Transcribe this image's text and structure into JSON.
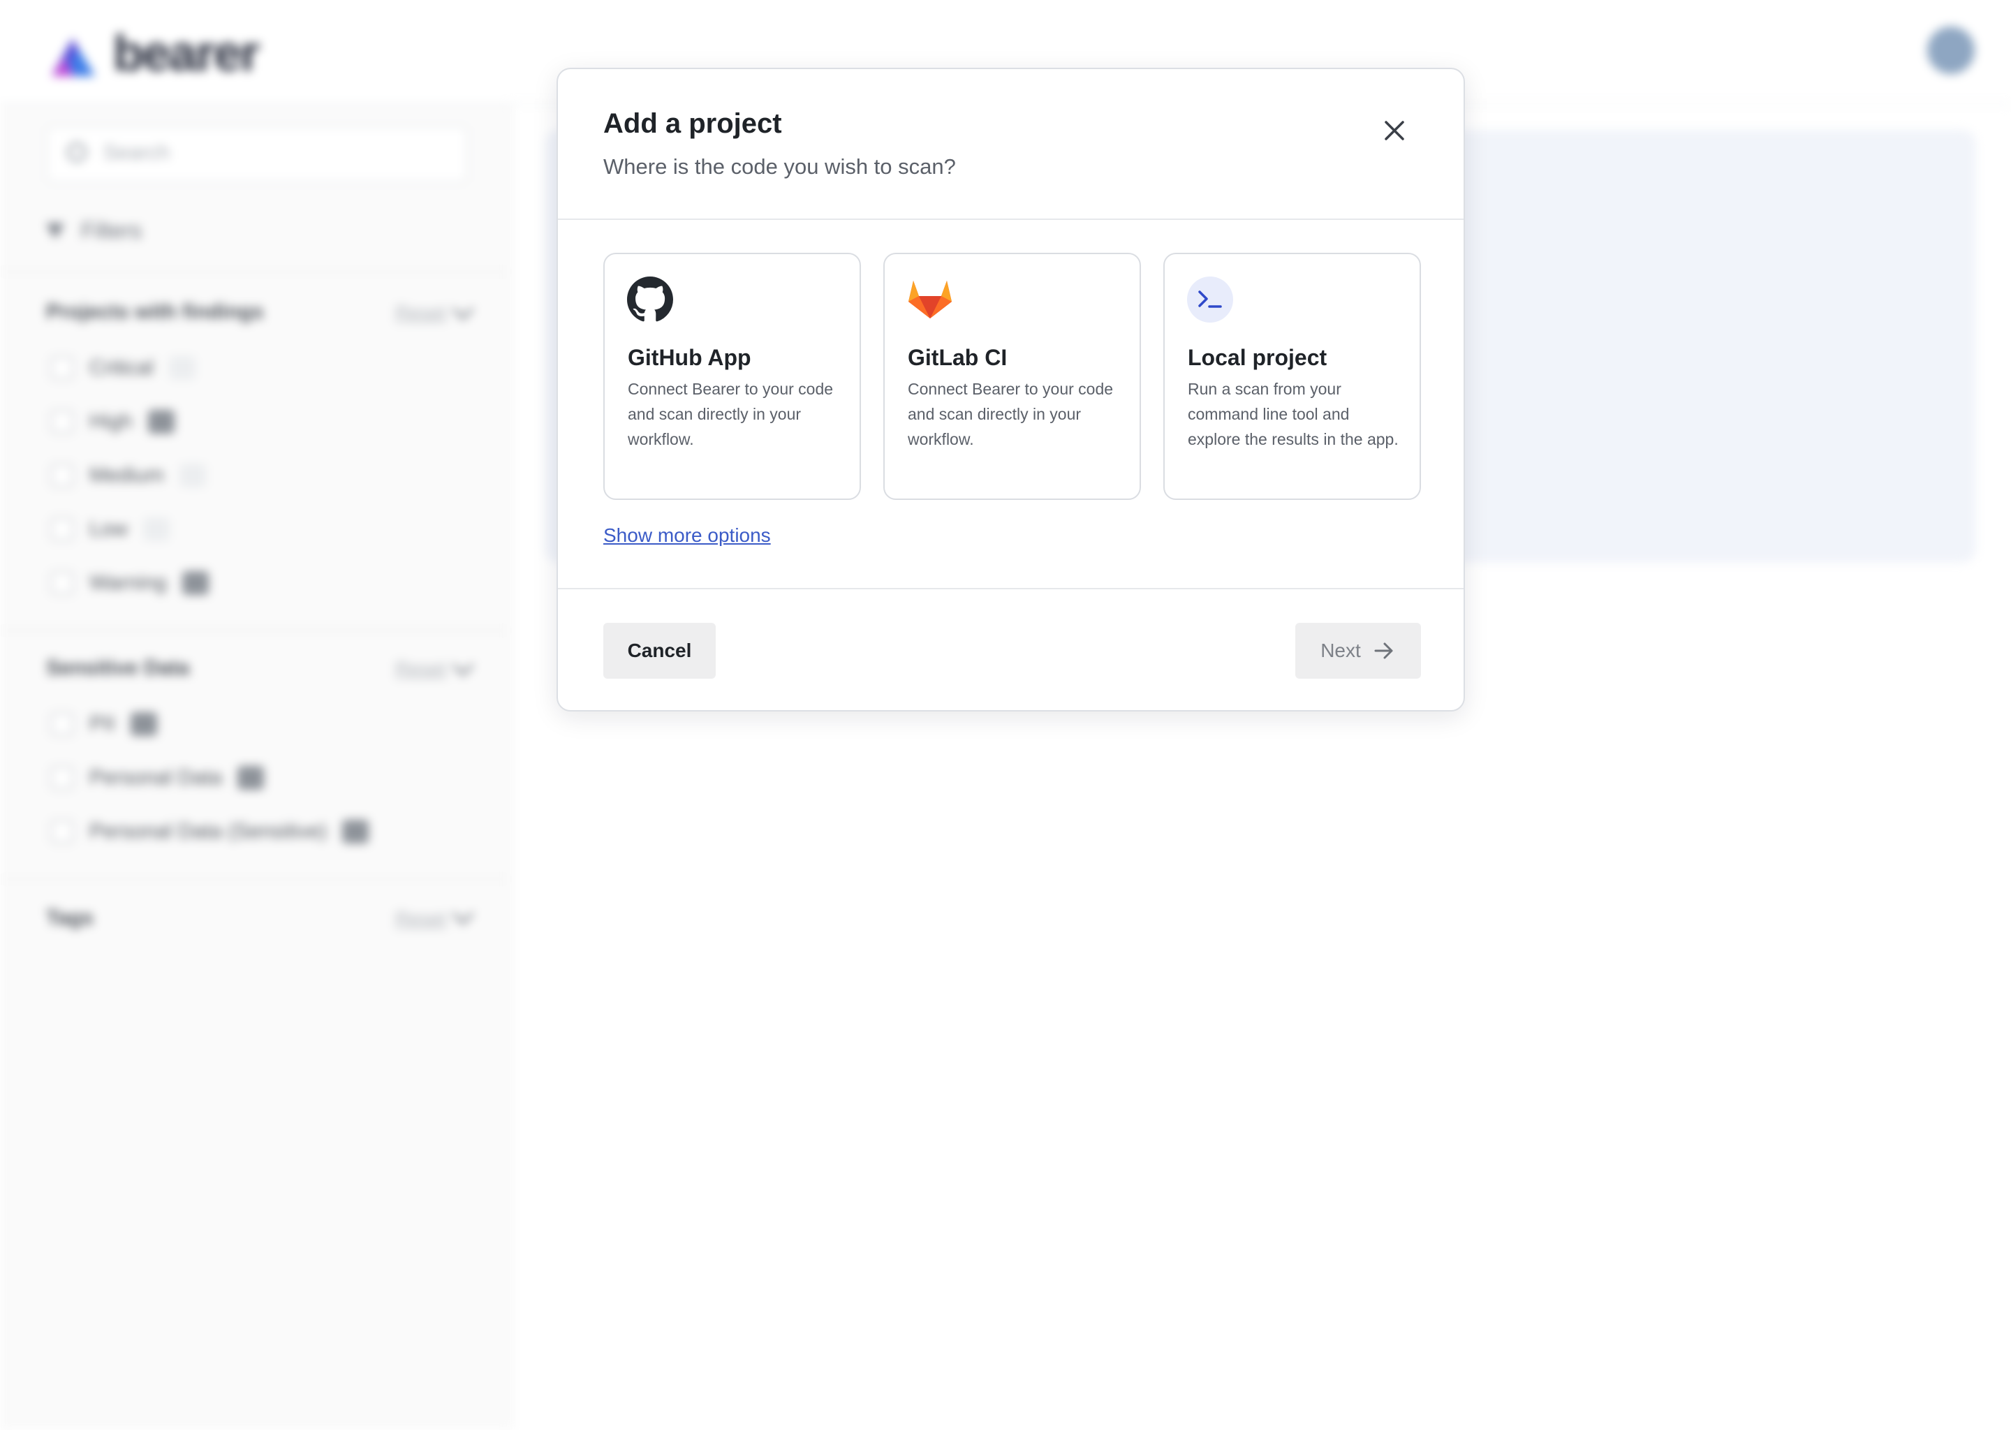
{
  "app": {
    "logo_text": "bearer"
  },
  "sidebar": {
    "search_placeholder": "Search",
    "filters_label": "Filters",
    "sections": [
      {
        "title": "Projects with findings",
        "reset": "Reset",
        "items": [
          {
            "label": "Critical",
            "count": ""
          },
          {
            "label": "High",
            "count": ""
          },
          {
            "label": "Medium",
            "count": ""
          },
          {
            "label": "Low",
            "count": ""
          },
          {
            "label": "Warning",
            "count": ""
          }
        ]
      },
      {
        "title": "Sensitive Data",
        "reset": "Reset",
        "items": [
          {
            "label": "PII",
            "count": ""
          },
          {
            "label": "Personal Data",
            "count": ""
          },
          {
            "label": "Personal Data (Sensitive)",
            "count": ""
          }
        ]
      },
      {
        "title": "Tags",
        "reset": "Reset",
        "items": []
      }
    ]
  },
  "modal": {
    "title": "Add a project",
    "subtitle": "Where is the code you wish to scan?",
    "options": [
      {
        "title": "GitHub App",
        "description": "Connect Bearer to your code and scan directly in your workflow.",
        "icon": "github-icon"
      },
      {
        "title": "GitLab CI",
        "description": "Connect Bearer to your code and scan directly in your workflow.",
        "icon": "gitlab-icon"
      },
      {
        "title": "Local project",
        "description": "Run a scan from your command line tool and explore the results in the app.",
        "icon": "terminal-icon"
      }
    ],
    "more_options_link": "Show more options",
    "cancel_label": "Cancel",
    "next_label": "Next"
  },
  "colors": {
    "link": "#3b5bc7",
    "gitlab_orange": "#e24329",
    "terminal_accent": "#2f49c9",
    "background_card": "#f1f4fa"
  }
}
